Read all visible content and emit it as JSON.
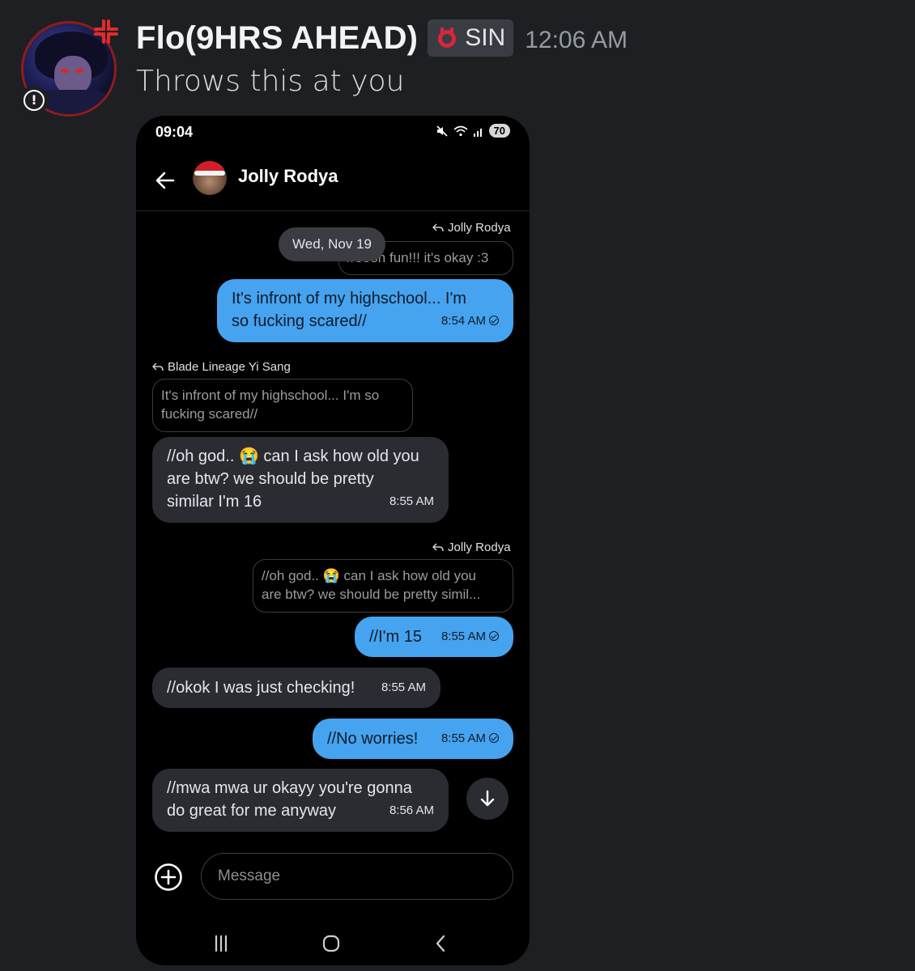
{
  "discord": {
    "username": "Flo(9HRS AHEAD)",
    "role_tag": "SIN",
    "timestamp": "12:06 AM",
    "message": "Throws this at you"
  },
  "phone": {
    "status_time": "09:04",
    "battery": "70",
    "contact_name": "Jolly Rodya",
    "date_pill": "Wed, Nov 19",
    "messages": [
      {
        "reply_to": "Jolly Rodya",
        "quote": "//oooh fun!!! it's okay :3"
      },
      {
        "text_line1": "It's infront of my highschool... I'm",
        "text_line2": "so fucking scared//",
        "time": "8:54 AM"
      },
      {
        "reply_to": "Blade Lineage Yi Sang",
        "quote_line1": "It's infront of my highschool... I'm so",
        "quote_line2": "fucking scared//"
      },
      {
        "text_line1": "//oh god.. 😭 can I ask how old you",
        "text_line2": "are btw? we should be pretty",
        "text_line3": "similar I'm 16",
        "time": "8:55 AM"
      },
      {
        "reply_to": "Jolly Rodya",
        "quote_line1": "//oh god.. 😭 can I ask how old you",
        "quote_line2": "are btw? we should be pretty simil..."
      },
      {
        "text": "//I'm 15",
        "time": "8:55 AM"
      },
      {
        "text": "//okok I was just checking!",
        "time": "8:55 AM"
      },
      {
        "text": "//No worries!",
        "time": "8:55 AM"
      },
      {
        "text_line1": "//mwa mwa ur okayy you're gonna",
        "text_line2": "do great for me anyway",
        "time": "8:56 AM"
      }
    ],
    "input_placeholder": "Message",
    "icons": {
      "back": "arrow-left-icon",
      "scroll_down": "arrow-down-icon",
      "add": "plus-circle-icon",
      "nav_recents": "recents-icon",
      "nav_home": "home-icon",
      "nav_back": "chevron-left-icon"
    }
  },
  "colors": {
    "background": "#1e1f22",
    "outgoing_bubble": "#46a3ef",
    "incoming_bubble": "#2a2c32"
  }
}
